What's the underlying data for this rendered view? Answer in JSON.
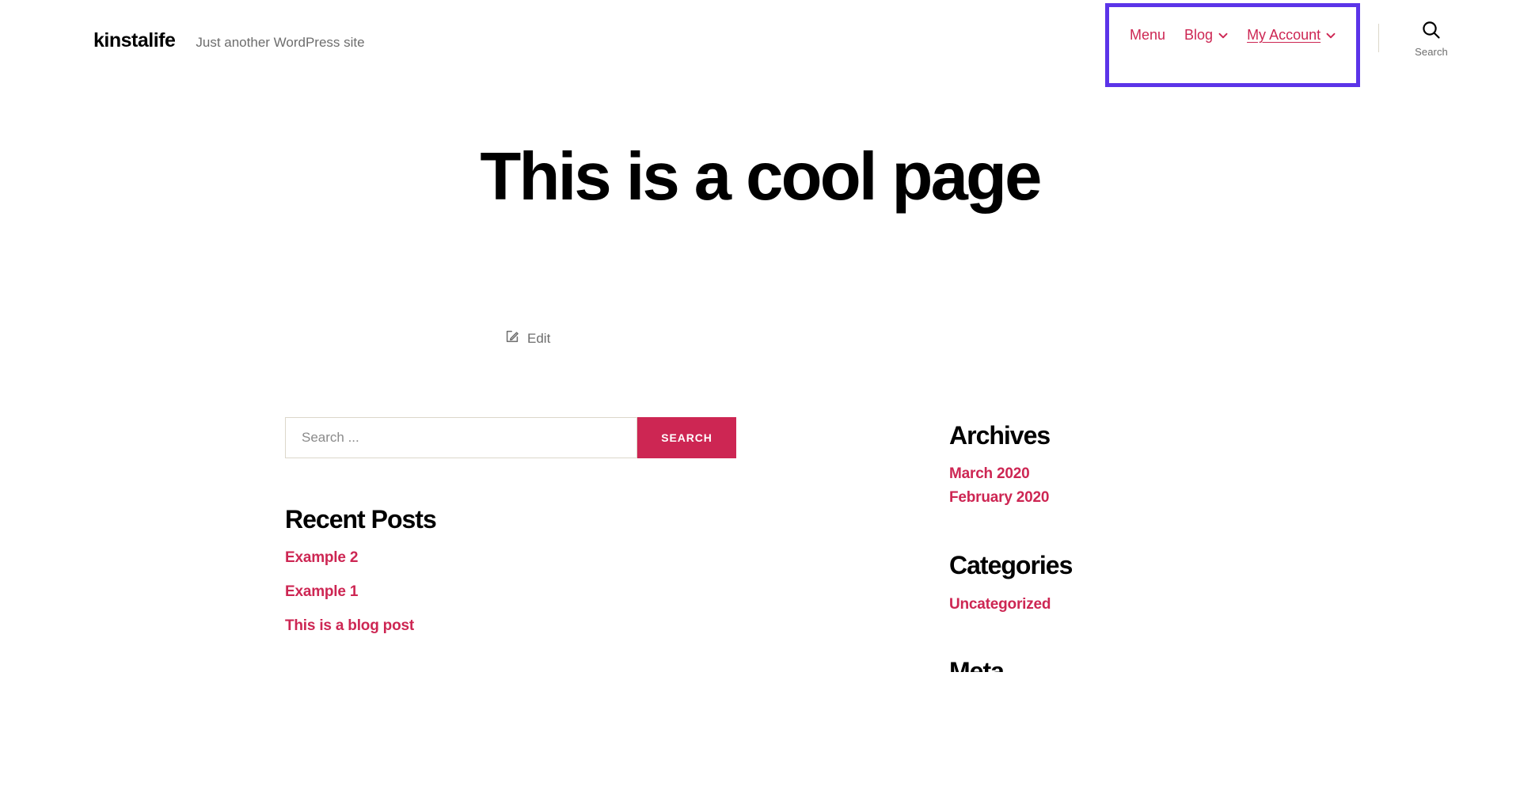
{
  "header": {
    "site_title": "kinstalife",
    "tagline": "Just another WordPress site",
    "nav": [
      {
        "label": "Menu",
        "has_chevron": false,
        "hovered": false,
        "icon": ""
      },
      {
        "label": "Blog",
        "has_chevron": true,
        "hovered": false,
        "icon": "chevron-down-icon"
      },
      {
        "label": "My Account",
        "has_chevron": true,
        "hovered": true,
        "icon": "chevron-down-icon"
      }
    ],
    "search_toggle_label": "Search",
    "search_icon": "search-icon",
    "highlight_color": "#5b34e8"
  },
  "main": {
    "page_title": "This is a cool page",
    "edit_label": "Edit",
    "edit_icon": "edit-pencil-icon"
  },
  "sidebar": {
    "search": {
      "placeholder": "Search ...",
      "value": "",
      "submit_label": "SEARCH"
    },
    "recent_posts": {
      "title": "Recent Posts",
      "items": [
        {
          "label": "Example 2"
        },
        {
          "label": "Example 1"
        },
        {
          "label": "This is a blog post"
        }
      ]
    },
    "archives": {
      "title": "Archives",
      "items": [
        {
          "label": "March 2020"
        },
        {
          "label": "February 2020"
        }
      ]
    },
    "categories": {
      "title": "Categories",
      "items": [
        {
          "label": "Uncategorized"
        }
      ]
    },
    "meta": {
      "title": "Meta"
    }
  },
  "colors": {
    "accent": "#cd2653",
    "text": "#000000",
    "muted": "#6d6d6d",
    "border": "#dcd7ca",
    "highlight": "#5b34e8",
    "background": "#ffffff"
  }
}
